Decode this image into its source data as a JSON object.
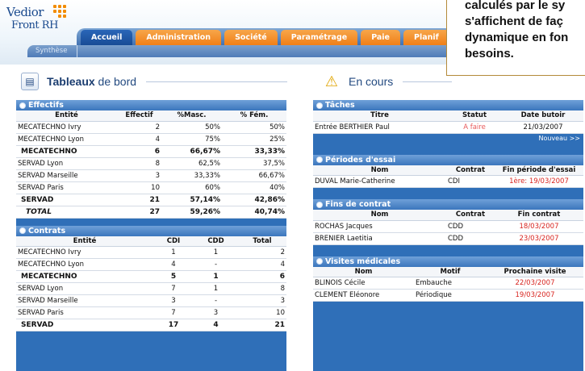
{
  "logo": {
    "line1": "Vedior",
    "line2": "Front RH"
  },
  "nav": {
    "tabs": [
      "Accueil",
      "Administration",
      "Société",
      "Paramétrage",
      "Paie",
      "Planif"
    ],
    "subtab": "Synthèse"
  },
  "callout": {
    "text": "calculés par le sy\ns'affichent de faç\ndynamique en fon\nbesoins."
  },
  "left_section": {
    "title_part1": "Tableaux",
    "title_part2": "de bord"
  },
  "right_section": {
    "title": "En cours"
  },
  "effectifs": {
    "title": "Effectifs",
    "headers": [
      "Entité",
      "Effectif",
      "%Masc.",
      "% Fém."
    ],
    "rows": [
      [
        "MECATECHNO Ivry",
        "2",
        "50%",
        "50%"
      ],
      [
        "MECATECHNO Lyon",
        "4",
        "75%",
        "25%"
      ],
      [
        "MECATECHNO",
        "6",
        "66,67%",
        "33,33%"
      ],
      [
        "SERVAD Lyon",
        "8",
        "62,5%",
        "37,5%"
      ],
      [
        "SERVAD Marseille",
        "3",
        "33,33%",
        "66,67%"
      ],
      [
        "SERVAD Paris",
        "10",
        "60%",
        "40%"
      ],
      [
        "SERVAD",
        "21",
        "57,14%",
        "42,86%"
      ],
      [
        "TOTAL",
        "27",
        "59,26%",
        "40,74%"
      ]
    ]
  },
  "contrats": {
    "title": "Contrats",
    "headers": [
      "Entité",
      "CDI",
      "CDD",
      "Total"
    ],
    "rows": [
      [
        "MECATECHNO Ivry",
        "1",
        "1",
        "2"
      ],
      [
        "MECATECHNO Lyon",
        "4",
        "-",
        "4"
      ],
      [
        "MECATECHNO",
        "5",
        "1",
        "6"
      ],
      [
        "SERVAD Lyon",
        "7",
        "1",
        "8"
      ],
      [
        "SERVAD Marseille",
        "3",
        "-",
        "3"
      ],
      [
        "SERVAD Paris",
        "7",
        "3",
        "10"
      ],
      [
        "SERVAD",
        "17",
        "4",
        "21"
      ]
    ]
  },
  "taches": {
    "title": "Tâches",
    "headers": [
      "Titre",
      "Statut",
      "Date butoir"
    ],
    "rows": [
      [
        "Entrée BERTHIER Paul",
        "A faire",
        "21/03/2007"
      ]
    ],
    "nouveau": "Nouveau >>"
  },
  "essai": {
    "title": "Périodes d'essai",
    "headers": [
      "Nom",
      "Contrat",
      "Fin période d'essai"
    ],
    "rows": [
      [
        "DUVAL Marie-Catherine",
        "CDI",
        "1ère: 19/03/2007"
      ]
    ]
  },
  "fins": {
    "title": "Fins de contrat",
    "headers": [
      "Nom",
      "Contrat",
      "Fin contrat"
    ],
    "rows": [
      [
        "ROCHAS Jacques",
        "CDD",
        "18/03/2007"
      ],
      [
        "BRENIER Laetitia",
        "CDD",
        "23/03/2007"
      ]
    ]
  },
  "visites": {
    "title": "Visites médicales",
    "headers": [
      "Nom",
      "Motif",
      "Prochaine visite"
    ],
    "rows": [
      [
        "BLINOIS Cécile",
        "Embauche",
        "22/03/2007"
      ],
      [
        "CLEMENT Eléonore",
        "Périodique",
        "19/03/2007"
      ]
    ]
  },
  "colors": {
    "accent_blue": "#2f6fb8",
    "tab_orange": "#ef7d14",
    "alert_red": "#d8241f"
  }
}
